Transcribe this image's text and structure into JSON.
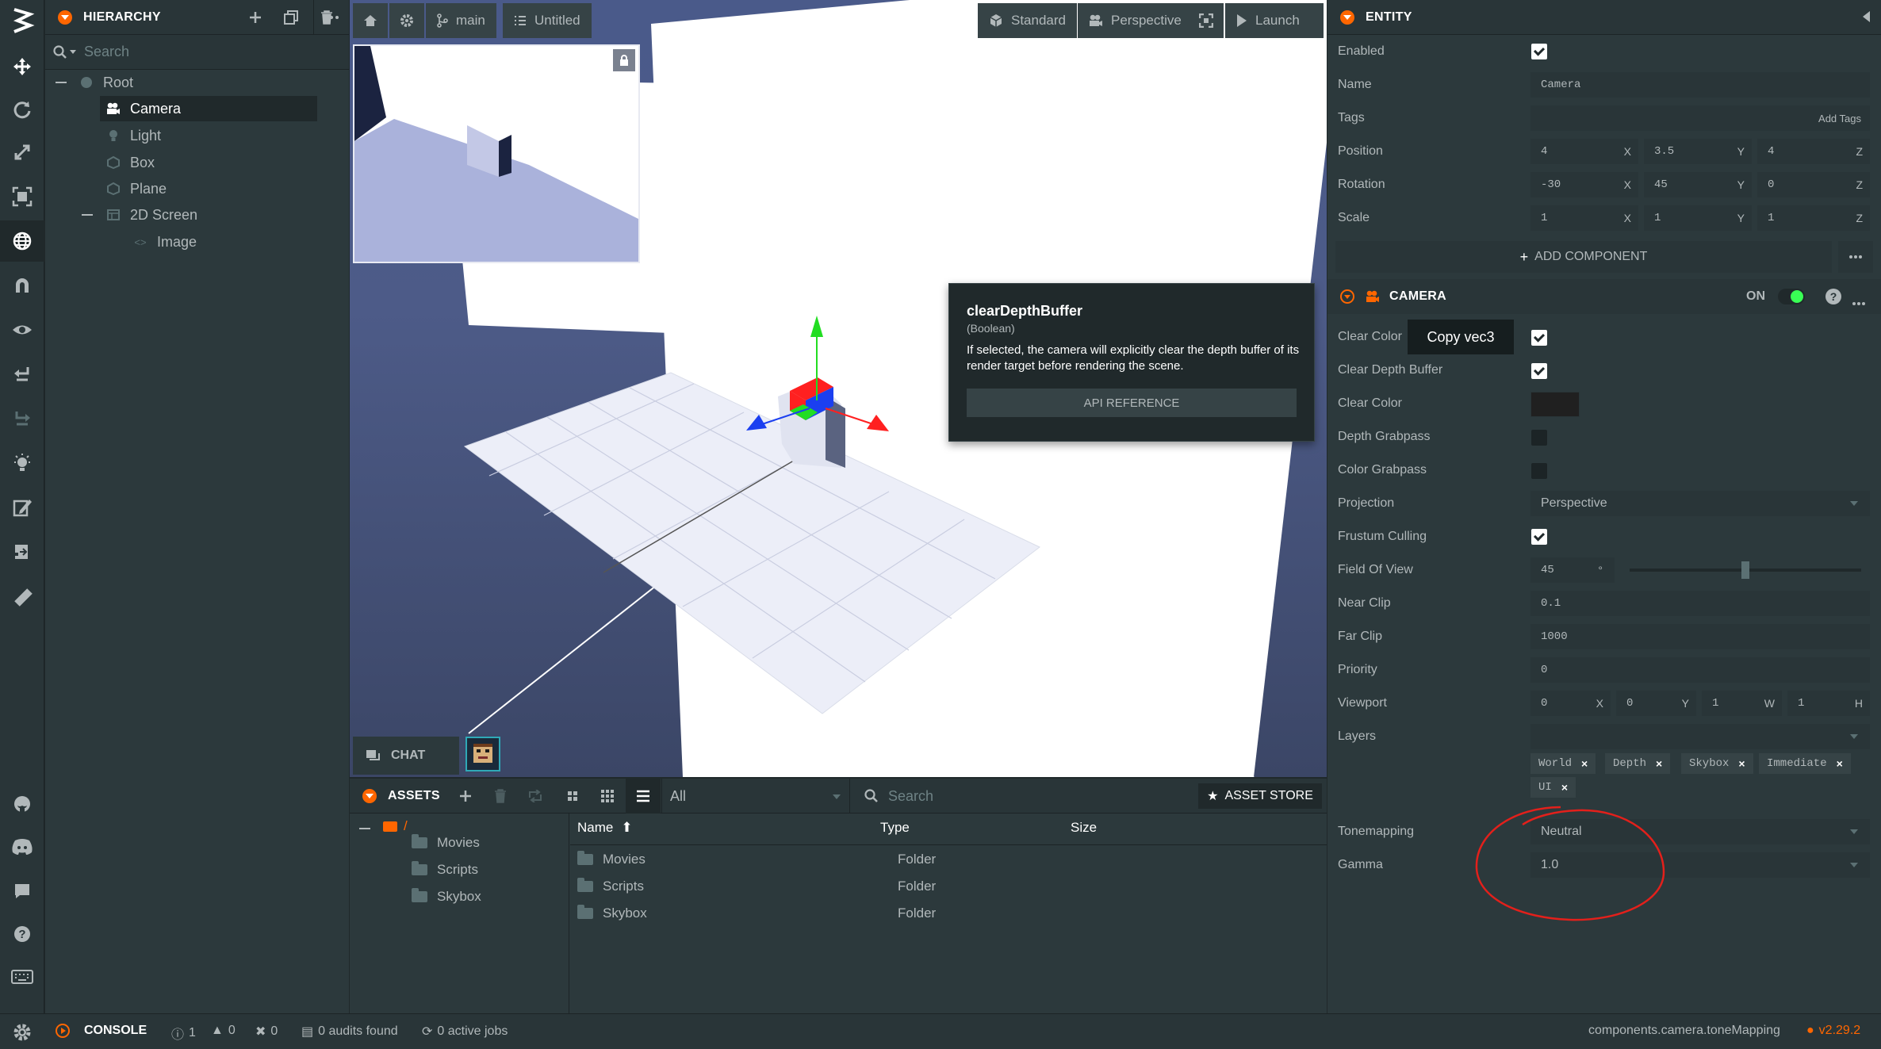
{
  "hierarchy": {
    "title": "HIERARCHY",
    "search_placeholder": "Search",
    "items": [
      {
        "label": "Root"
      },
      {
        "label": "Camera"
      },
      {
        "label": "Light"
      },
      {
        "label": "Box"
      },
      {
        "label": "Plane"
      },
      {
        "label": "2D Screen"
      },
      {
        "label": "Image"
      }
    ]
  },
  "viewport": {
    "branch": "main",
    "scene": "Untitled",
    "render_mode": "Standard",
    "projection": "Perspective",
    "launch": "Launch",
    "chat": "CHAT"
  },
  "tooltip": {
    "title": "clearDepthBuffer",
    "type": "(Boolean)",
    "description": "If selected, the camera will explicitly clear the depth buffer of its render target before rendering the scene.",
    "button": "API REFERENCE"
  },
  "copy_hint": "Copy vec3",
  "assets": {
    "title": "ASSETS",
    "filter": "All",
    "search_placeholder": "Search",
    "store": "ASSET STORE",
    "root": "/",
    "tree": [
      "Movies",
      "Scripts",
      "Skybox"
    ],
    "columns": {
      "name": "Name",
      "type": "Type",
      "size": "Size"
    },
    "rows": [
      {
        "name": "Movies",
        "type": "Folder",
        "size": ""
      },
      {
        "name": "Scripts",
        "type": "Folder",
        "size": ""
      },
      {
        "name": "Skybox",
        "type": "Folder",
        "size": ""
      }
    ]
  },
  "entity": {
    "title": "ENTITY",
    "enabled_label": "Enabled",
    "name_label": "Name",
    "name_value": "Camera",
    "tags_label": "Tags",
    "tags_button": "Add Tags",
    "position_label": "Position",
    "position": [
      "4",
      "3.5",
      "4"
    ],
    "rotation_label": "Rotation",
    "rotation": [
      "-30",
      "45",
      "0"
    ],
    "scale_label": "Scale",
    "scale": [
      "1",
      "1",
      "1"
    ],
    "axes": [
      "X",
      "Y",
      "Z"
    ],
    "add_component": "ADD COMPONENT"
  },
  "camera": {
    "title": "CAMERA",
    "on_label": "ON",
    "clear_color_buffer_label": "Clear Color",
    "clear_depth_buffer_label": "Clear Depth Buffer",
    "clear_color_label": "Clear Color",
    "clear_color_value": "#202020",
    "depth_grabpass_label": "Depth Grabpass",
    "color_grabpass_label": "Color Grabpass",
    "projection_label": "Projection",
    "projection_value": "Perspective",
    "frustum_label": "Frustum Culling",
    "fov_label": "Field Of View",
    "fov_value": "45",
    "fov_unit": "°",
    "fov_fraction": 0.5,
    "near_label": "Near Clip",
    "near_value": "0.1",
    "far_label": "Far Clip",
    "far_value": "1000",
    "priority_label": "Priority",
    "priority_value": "0",
    "viewport_label": "Viewport",
    "viewport_values": [
      "0",
      "0",
      "1",
      "1"
    ],
    "viewport_axes": [
      "X",
      "Y",
      "W",
      "H"
    ],
    "layers_label": "Layers",
    "layers": [
      "World",
      "Depth",
      "Skybox",
      "Immediate",
      "UI"
    ],
    "tonemapping_label": "Tonemapping",
    "tonemapping_value": "Neutral",
    "gamma_label": "Gamma",
    "gamma_value": "1.0"
  },
  "status": {
    "console": "CONSOLE",
    "info_count": "1",
    "warn_count": "0",
    "error_count": "0",
    "audits": "0 audits found",
    "jobs": "0 active jobs",
    "path": "components.camera.toneMapping",
    "version": "v2.29.2"
  },
  "colors": {
    "accent": "#ff6600",
    "annotation": "#e3201b",
    "toggle_on": "#39ff55"
  }
}
